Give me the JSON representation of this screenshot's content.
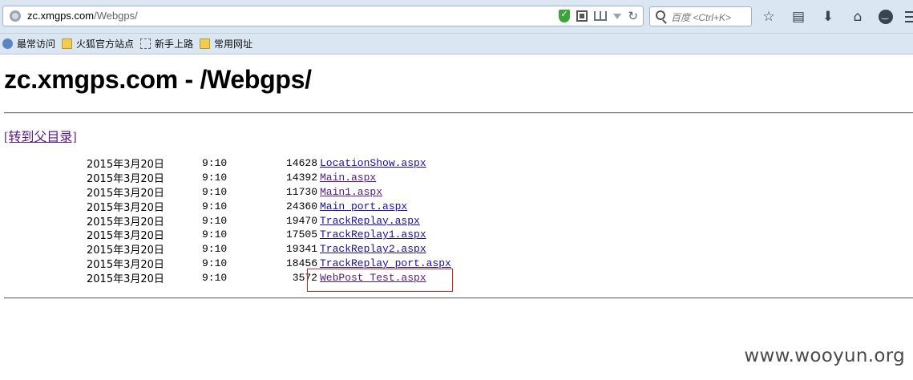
{
  "browser": {
    "url_host": "zc.xmgps.com",
    "url_path": "/Webgps/",
    "search_placeholder": "百度 <Ctrl+K>"
  },
  "bookmarks": [
    {
      "label": "最常访问",
      "icon": "bookmark-star-icon"
    },
    {
      "label": "火狐官方站点",
      "icon": "folder-icon"
    },
    {
      "label": "新手上路",
      "icon": "dashed-folder-icon"
    },
    {
      "label": "常用网址",
      "icon": "folder-icon"
    }
  ],
  "page": {
    "title": "zc.xmgps.com - /Webgps/",
    "parent_link": "[转到父目录]",
    "files": [
      {
        "date": "2015年3月20日",
        "time": "9:10",
        "size": "14628",
        "name": "LocationShow.aspx"
      },
      {
        "date": "2015年3月20日",
        "time": "9:10",
        "size": "14392",
        "name": "Main.aspx"
      },
      {
        "date": "2015年3月20日",
        "time": "9:10",
        "size": "11730",
        "name": "Main1.aspx"
      },
      {
        "date": "2015年3月20日",
        "time": "9:10",
        "size": "24360",
        "name": "Main_port.aspx"
      },
      {
        "date": "2015年3月20日",
        "time": "9:10",
        "size": "19470",
        "name": "TrackReplay.aspx"
      },
      {
        "date": "2015年3月20日",
        "time": "9:10",
        "size": "17505",
        "name": "TrackReplay1.aspx"
      },
      {
        "date": "2015年3月20日",
        "time": "9:10",
        "size": "19341",
        "name": "TrackReplay2.aspx"
      },
      {
        "date": "2015年3月20日",
        "time": "9:10",
        "size": "18456",
        "name": "TrackReplay_port.aspx"
      },
      {
        "date": "2015年3月20日",
        "time": "9:10",
        "size": "3572",
        "name": "WebPost_Test.aspx"
      }
    ],
    "watermark": "www.wooyun.org"
  },
  "colors": {
    "highlight": "#e02020",
    "link": "#1a0dab",
    "visited": "#551a8b"
  }
}
